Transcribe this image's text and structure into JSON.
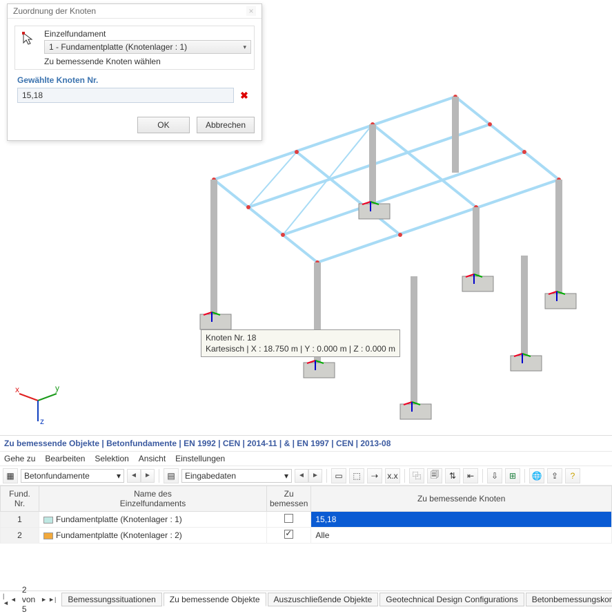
{
  "dialog": {
    "title": "Zuordnung der Knoten",
    "single_foundation_label": "Einzelfundament",
    "foundation_select": "1 - Fundamentplatte (Knotenlager : 1)",
    "select_hint": "Zu bemessende Knoten wählen",
    "section_label": "Gewählte Knoten Nr.",
    "input_value": "15,18",
    "ok": "OK",
    "cancel": "Abbrechen"
  },
  "tooltip": {
    "line1": "Knoten Nr. 18",
    "line2": "Kartesisch | X : 18.750 m | Y : 0.000 m | Z : 0.000 m"
  },
  "panel": {
    "title": "Zu bemessende Objekte | Betonfundamente | EN 1992 | CEN | 2014-11 | & | EN 1997 | CEN | 2013-08",
    "menu": {
      "goto": "Gehe zu",
      "edit": "Bearbeiten",
      "sel": "Selektion",
      "view": "Ansicht",
      "settings": "Einstellungen"
    },
    "combo1": "Betonfundamente",
    "combo2": "Eingabedaten"
  },
  "table": {
    "h1": "Fund.\nNr.",
    "h2": "Name des\nEinzelfundaments",
    "h3": "Zu\nbemessen",
    "h4": "Zu bemessende Knoten",
    "rows": [
      {
        "num": "1",
        "swatch": "#bfe8e3",
        "name": "Fundamentplatte (Knotenlager : 1)",
        "checked": false,
        "nodes": "15,18"
      },
      {
        "num": "2",
        "swatch": "#f2a93c",
        "name": "Fundamentplatte (Knotenlager : 2)",
        "checked": true,
        "nodes": "Alle"
      }
    ]
  },
  "bottom": {
    "pager": "2 von 5",
    "tabs": {
      "t1": "Bemessungssituationen",
      "t2": "Zu bemessende Objekte",
      "t3": "Auszuschließende Objekte",
      "t4": "Geotechnical Design Configurations",
      "t5": "Betonbemessungskonfigurationen"
    }
  },
  "axes": {
    "x": "x",
    "y": "y",
    "z": "z"
  }
}
